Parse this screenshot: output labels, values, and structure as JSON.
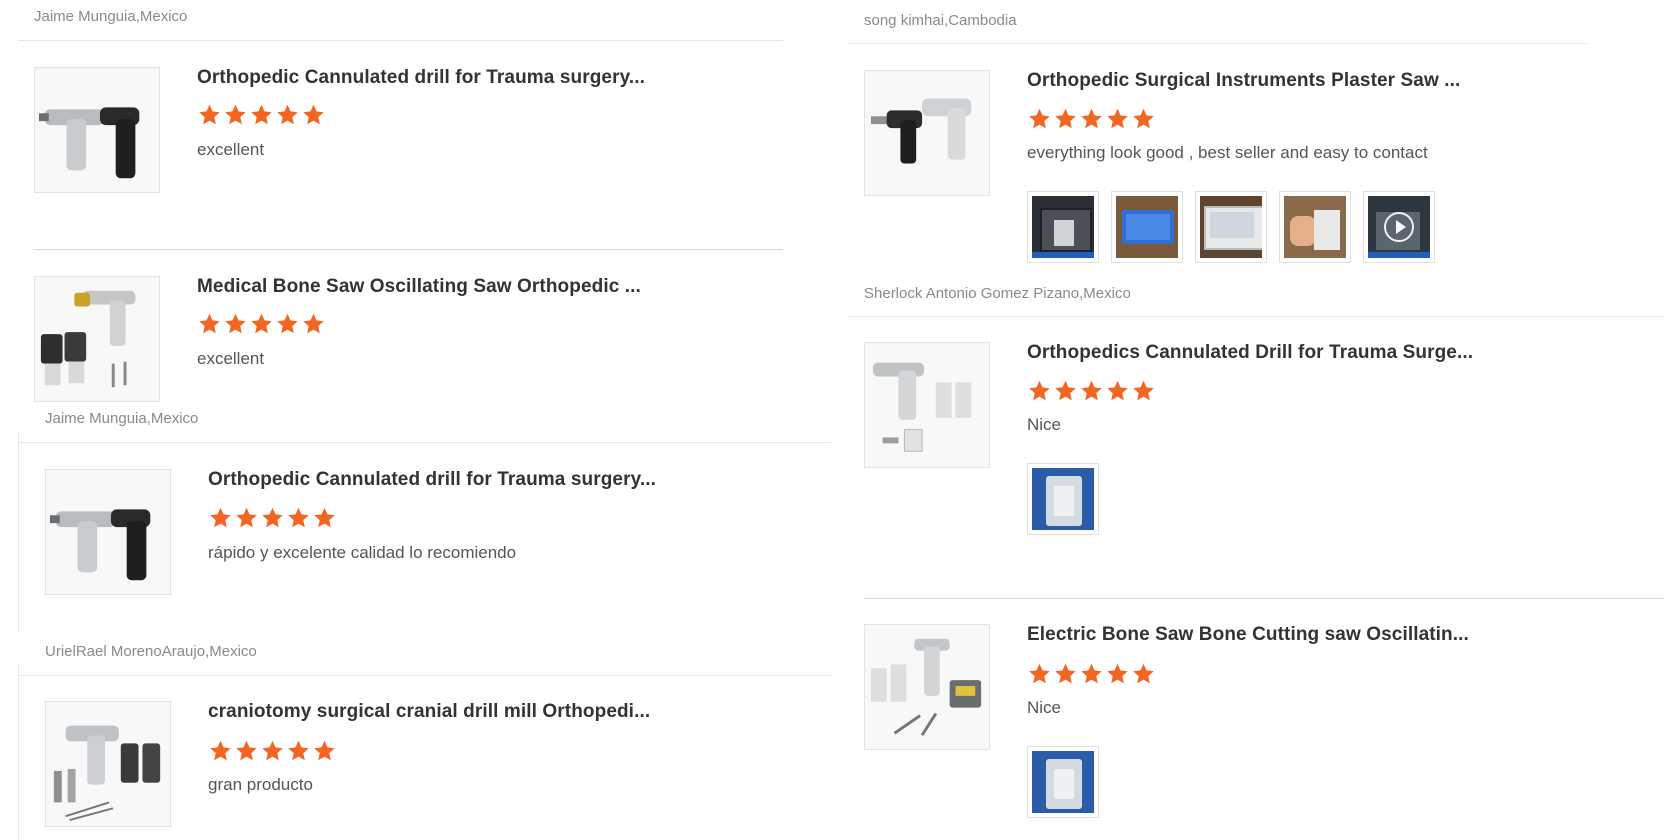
{
  "colors": {
    "star": "#F26522",
    "divider": "#e6e6e6",
    "reviewer": "#8a8a8a"
  },
  "left": {
    "reviews": [
      {
        "reviewer": "Jaime Munguia,Mexico",
        "product": "Orthopedic Cannulated drill for Trauma surgery...",
        "rating": 5,
        "comment": "excellent",
        "image": "cannulated-drill-image"
      },
      {
        "reviewer": "",
        "product": "Medical Bone Saw Oscillating Saw Orthopedic ...",
        "rating": 5,
        "comment": "excellent",
        "image": "oscillating-saw-image"
      },
      {
        "reviewer": "Jaime Munguia,Mexico",
        "product": "Orthopedic Cannulated drill for Trauma surgery...",
        "rating": 5,
        "comment": "rápido y excelente calidad lo recomiendo",
        "image": "cannulated-drill-image"
      },
      {
        "reviewer": "UrielRael MorenoAraujo,Mexico",
        "product": "craniotomy surgical cranial drill mill Orthopedi...",
        "rating": 5,
        "comment": "gran producto",
        "image": "cranial-drill-image"
      }
    ]
  },
  "right": {
    "reviews": [
      {
        "reviewer": "song kimhai,Cambodia",
        "product": "Orthopedic Surgical Instruments Plaster Saw ...",
        "rating": 5,
        "comment": "everything look good , best seller and easy to contact",
        "image": "plaster-saw-image",
        "photos": [
          "photo-case-open",
          "photo-case-closed",
          "photo-tablet",
          "photo-hand",
          "video-thumb"
        ]
      },
      {
        "reviewer": "Sherlock Antonio Gomez Pizano,Mexico",
        "product": "Orthopedics Cannulated Drill for Trauma Surge...",
        "rating": 5,
        "comment": "Nice",
        "image": "cannulated-drill-set-image",
        "photos": [
          "photo-packaged-drill"
        ]
      },
      {
        "reviewer": "",
        "product": "Electric Bone Saw Bone Cutting saw Oscillatin...",
        "rating": 5,
        "comment": "Nice",
        "image": "bone-saw-set-image",
        "photos": [
          "photo-packaged-saw"
        ]
      }
    ]
  }
}
